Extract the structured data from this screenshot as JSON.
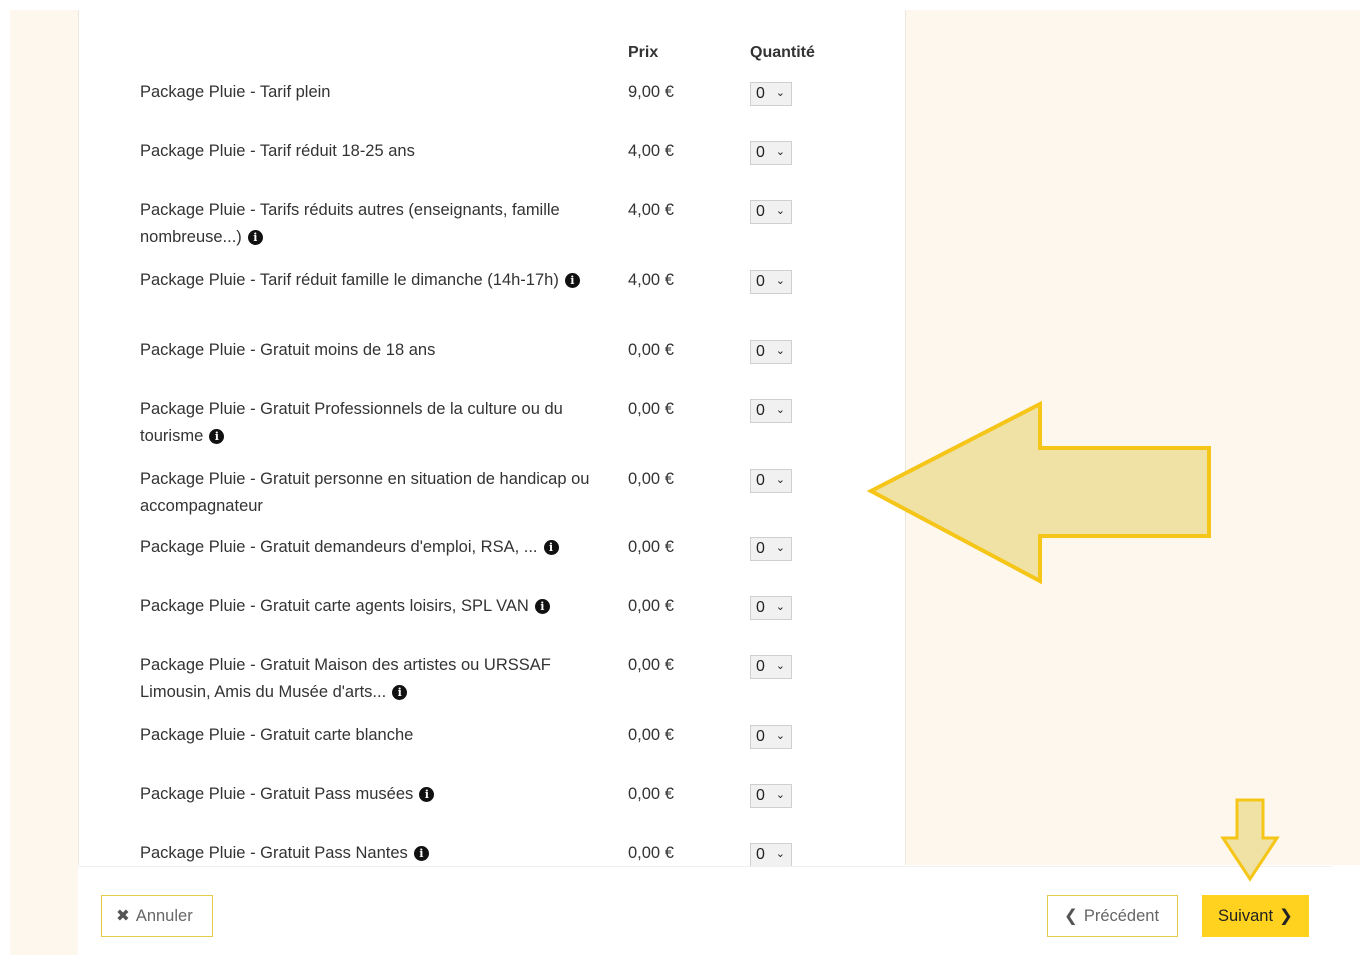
{
  "columns": {
    "price": "Prix",
    "quantity": "Quantité"
  },
  "tickets": [
    {
      "name": "Package Pluie - Tarif plein",
      "price": "9,00 €",
      "qty": "0",
      "info": false
    },
    {
      "name": "Package Pluie - Tarif réduit 18-25 ans",
      "price": "4,00 €",
      "qty": "0",
      "info": false
    },
    {
      "name": "Package Pluie - Tarifs réduits autres (enseignants, famille nombreuse...)",
      "price": "4,00 €",
      "qty": "0",
      "info": true
    },
    {
      "name": "Package Pluie - Tarif réduit famille le dimanche (14h-17h)",
      "price": "4,00 €",
      "qty": "0",
      "info": true
    },
    {
      "name": "Package Pluie - Gratuit moins de 18 ans",
      "price": "0,00 €",
      "qty": "0",
      "info": false
    },
    {
      "name": "Package Pluie - Gratuit Professionnels de la culture ou du tourisme",
      "price": "0,00 €",
      "qty": "0",
      "info": true
    },
    {
      "name": "Package Pluie - Gratuit personne en situation de handicap ou accompagnateur",
      "price": "0,00 €",
      "qty": "0",
      "info": false
    },
    {
      "name": "Package Pluie - Gratuit demandeurs d'emploi, RSA, ...",
      "price": "0,00 €",
      "qty": "0",
      "info": true
    },
    {
      "name": "Package Pluie - Gratuit carte agents loisirs, SPL VAN",
      "price": "0,00 €",
      "qty": "0",
      "info": true
    },
    {
      "name": "Package Pluie - Gratuit Maison des artistes ou URSSAF Limousin, Amis du Musée d'arts...",
      "price": "0,00 €",
      "qty": "0",
      "info": true
    },
    {
      "name": "Package Pluie - Gratuit carte blanche",
      "price": "0,00 €",
      "qty": "0",
      "info": false
    },
    {
      "name": "Package Pluie - Gratuit Pass musées",
      "price": "0,00 €",
      "qty": "0",
      "info": true
    },
    {
      "name": "Package Pluie - Gratuit Pass Nantes",
      "price": "0,00 €",
      "qty": "0",
      "info": true
    }
  ],
  "footer": {
    "cancel_label": "Annuler",
    "prev_label": "Précédent",
    "next_label": "Suivant"
  },
  "icons": {
    "cancel": "times-icon",
    "prev": "chevron-left-icon",
    "next": "chevron-right-icon",
    "info": "info-circle-icon",
    "select": "chevron-down-icon"
  },
  "colors": {
    "accent": "#ffd21f",
    "button_border": "#e6cc4c",
    "page_bg": "#fdf7ee",
    "annotation_fill": "#efe2a4",
    "annotation_stroke": "#f5c518"
  }
}
